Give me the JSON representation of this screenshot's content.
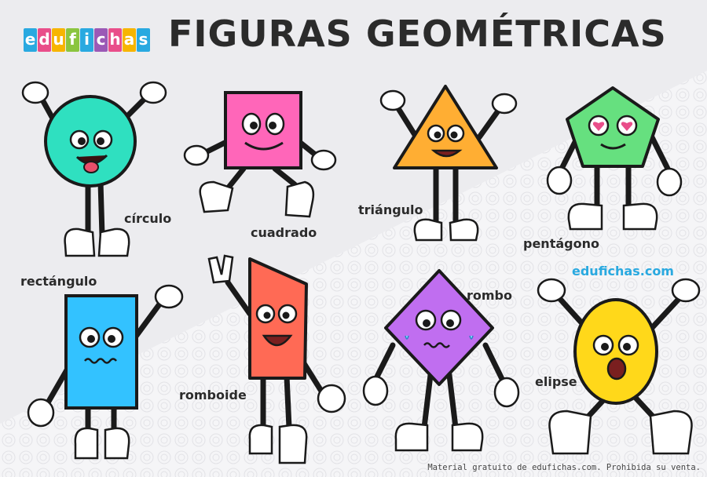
{
  "brand": {
    "letters": [
      "e",
      "d",
      "u",
      "f",
      "i",
      "c",
      "h",
      "a",
      "s"
    ],
    "letter_colors": [
      "#29a9e0",
      "#e94e8a",
      "#f7b500",
      "#8bc53f",
      "#29a9e0",
      "#9b59b6",
      "#e94e8a",
      "#f7b500",
      "#29a9e0"
    ]
  },
  "title": "FIGURAS  GEOMÉTRICAS",
  "shapes": [
    {
      "key": "circulo",
      "label": "círculo",
      "color": "#2fe0c0",
      "icon": "circle-character"
    },
    {
      "key": "cuadrado",
      "label": "cuadrado",
      "color": "#ff66b9",
      "icon": "square-character"
    },
    {
      "key": "triangulo",
      "label": "triángulo",
      "color": "#ffae33",
      "icon": "triangle-character"
    },
    {
      "key": "pentagono",
      "label": "pentágono",
      "color": "#66e07f",
      "icon": "pentagon-character"
    },
    {
      "key": "rectangulo",
      "label": "rectángulo",
      "color": "#33c2ff",
      "icon": "rectangle-character"
    },
    {
      "key": "romboide",
      "label": "romboide",
      "color": "#ff6a55",
      "icon": "parallelogram-character"
    },
    {
      "key": "rombo",
      "label": "rombo",
      "color": "#c06ef0",
      "icon": "rhombus-character"
    },
    {
      "key": "elipse",
      "label": "elipse",
      "color": "#ffd81a",
      "icon": "ellipse-character"
    }
  ],
  "website": "edufichas.com",
  "footer": "Material gratuito de edufichas.com. Prohibida su venta."
}
